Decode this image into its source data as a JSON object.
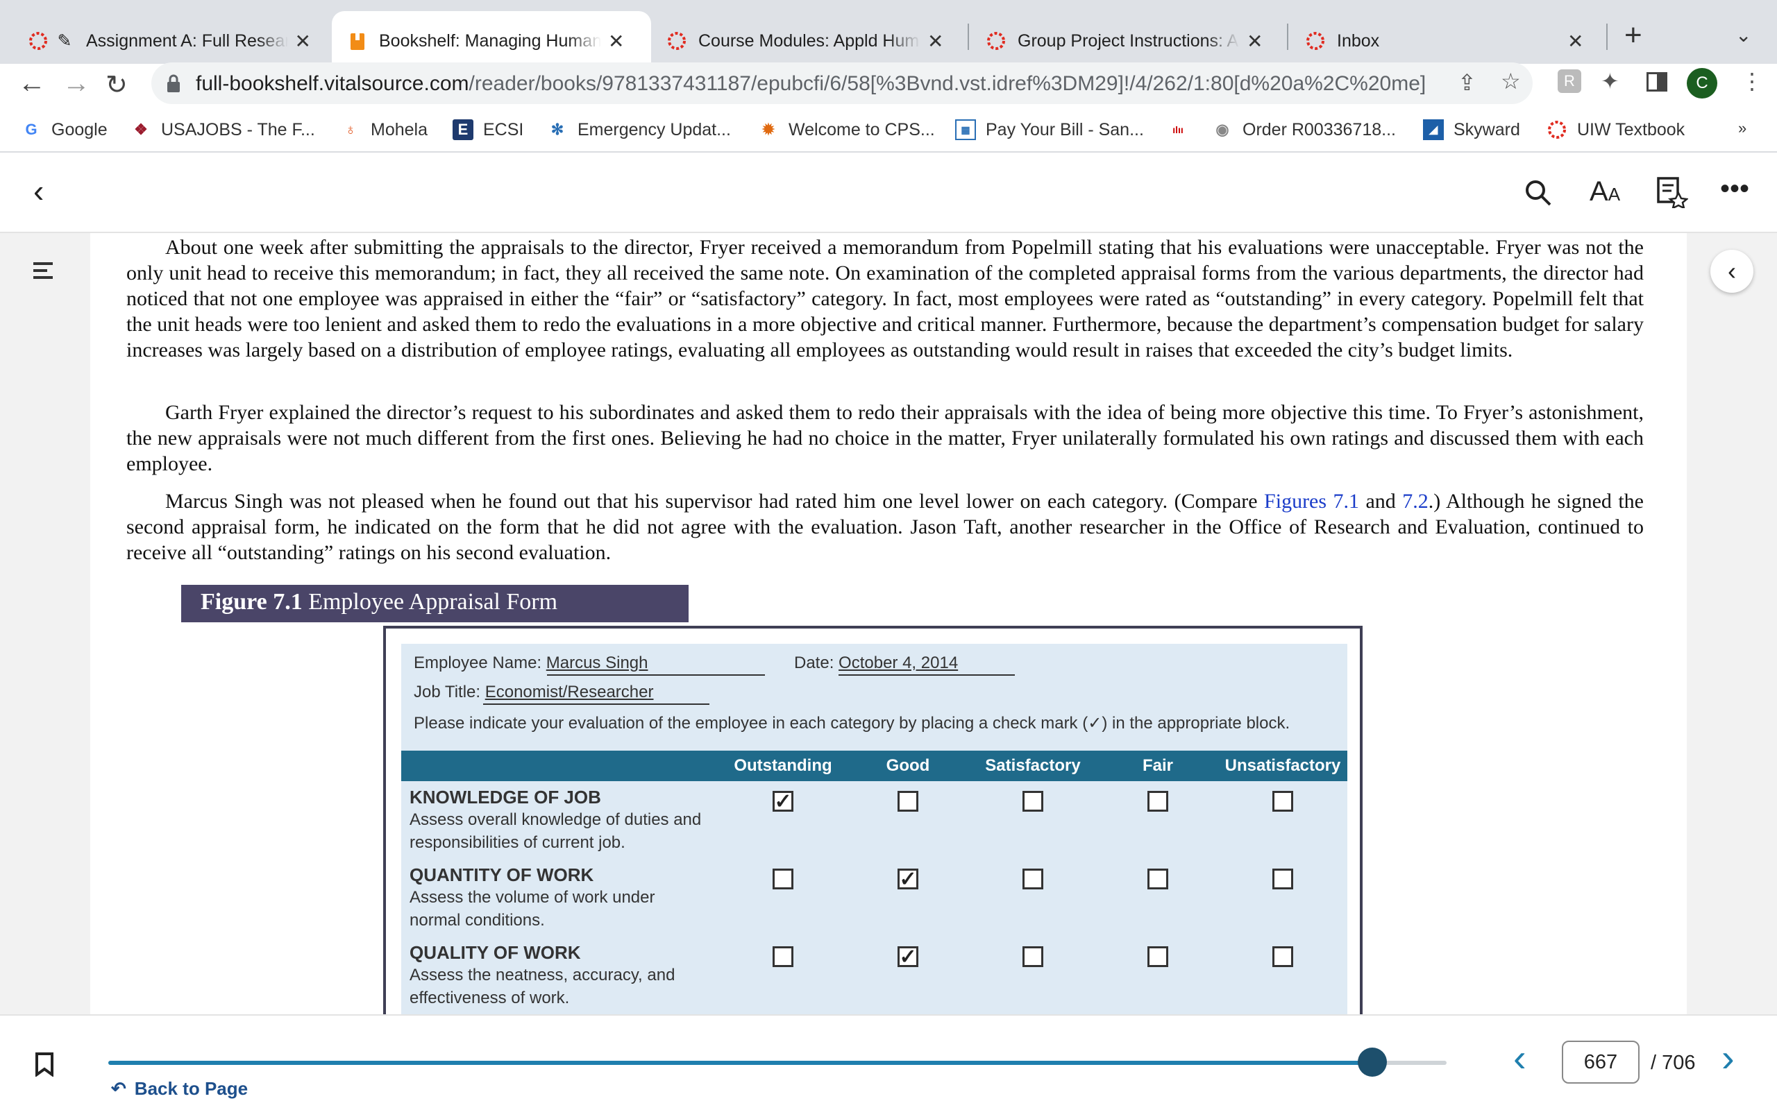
{
  "tabs": [
    {
      "title": "Assignment A: Full Research",
      "active": false
    },
    {
      "title": "Bookshelf: Managing Human Resources",
      "active": true
    },
    {
      "title": "Course Modules: Appld Human",
      "active": false
    },
    {
      "title": "Group Project Instructions: Assignment",
      "active": false
    },
    {
      "title": "Inbox",
      "active": false
    }
  ],
  "address_bar": {
    "host": "full-bookshelf.vitalsource.com",
    "path": "/reader/books/9781337431187/epubcfi/6/58[%3Bvnd.vst.idref%3DM29]!/4/262/1:80[d%20a%2C%20me]"
  },
  "profile_initial": "C",
  "bookmarks": [
    {
      "label": "Google",
      "icon": "google-icon"
    },
    {
      "label": "USAJOBS - The F...",
      "icon": "usajobs-icon"
    },
    {
      "label": "Mohela",
      "icon": "mohela-icon"
    },
    {
      "label": "ECSI",
      "icon": "ecsi-icon"
    },
    {
      "label": "Emergency Updat...",
      "icon": "snowflake-icon"
    },
    {
      "label": "Welcome to CPS...",
      "icon": "cps-icon"
    },
    {
      "label": "Pay Your Bill - San...",
      "icon": "bill-icon"
    },
    {
      "label": "",
      "icon": "cisco-icon"
    },
    {
      "label": "Order R00336718...",
      "icon": "order-icon"
    },
    {
      "label": "Skyward",
      "icon": "skyward-icon"
    },
    {
      "label": "UIW Textbook",
      "icon": "uiw-icon"
    }
  ],
  "bookmarks_overflow": "»",
  "paragraphs": [
    "About one week after submitting the appraisals to the director, Fryer received a memorandum from Popelmill stating that his evaluations were unacceptable. Fryer was not the only unit head to receive this memorandum; in fact, they all received the same note. On examination of the completed appraisal forms from the various departments, the director had noticed that not one employee was appraised in either the “fair” or “satisfactory” category. In fact, most employees were rated as “outstanding” in every category. Popelmill felt that the unit heads were too lenient and asked them to redo the evaluations in a more objective and critical manner. Furthermore, because the department’s compensation budget for salary increases was largely based on a distribution of employee ratings, evaluating all employees as outstanding would result in raises that exceeded the city’s budget limits.",
    "Garth Fryer explained the director’s request to his subordinates and asked them to redo their appraisals with the idea of being more objective this time. To Fryer’s astonishment, the new appraisals were not much different from the first ones. Believing he had no choice in the matter, Fryer unilaterally formulated his own ratings and discussed them with each employee."
  ],
  "para3": {
    "before": "Marcus Singh was not pleased when he found out that his supervisor had rated him one level lower on each category. (Compare ",
    "link1": "Figures 7.1",
    "mid": " and ",
    "link2": "7.2",
    "after": ".) Although he signed the second appraisal form, he indicated on the form that he did not agree with the evaluation. Jason Taft, another researcher in the Office of Research and Evaluation, continued to receive all “outstanding” ratings on his second evaluation."
  },
  "figure": {
    "label": "Figure 7.1",
    "title": "Employee Appraisal Form",
    "employee_name_label": "Employee Name:",
    "employee_name": "Marcus Singh",
    "date_label": "Date:",
    "date": "October 4, 2014",
    "job_title_label": "Job Title:",
    "job_title": "Economist/Researcher",
    "instruction": "Please indicate your evaluation of the employee in each category by placing a check mark (✓) in the appropriate block.",
    "columns": [
      "Outstanding",
      "Good",
      "Satisfactory",
      "Fair",
      "Unsatisfactory"
    ],
    "rows": [
      {
        "name": "KNOWLEDGE OF JOB",
        "desc1": "Assess overall knowledge of duties and",
        "desc2": "responsibilities of current job.",
        "checked": 0
      },
      {
        "name": "QUANTITY OF WORK",
        "desc1": "Assess the volume of work under",
        "desc2": "normal conditions.",
        "checked": 1
      },
      {
        "name": "QUALITY OF WORK",
        "desc1": "Assess the neatness, accuracy, and",
        "desc2": "effectiveness of work.",
        "checked": 1
      }
    ]
  },
  "pager": {
    "current": "667",
    "total": "/ 706",
    "progress": 0.9447
  },
  "back_to_page": "Back to Page"
}
